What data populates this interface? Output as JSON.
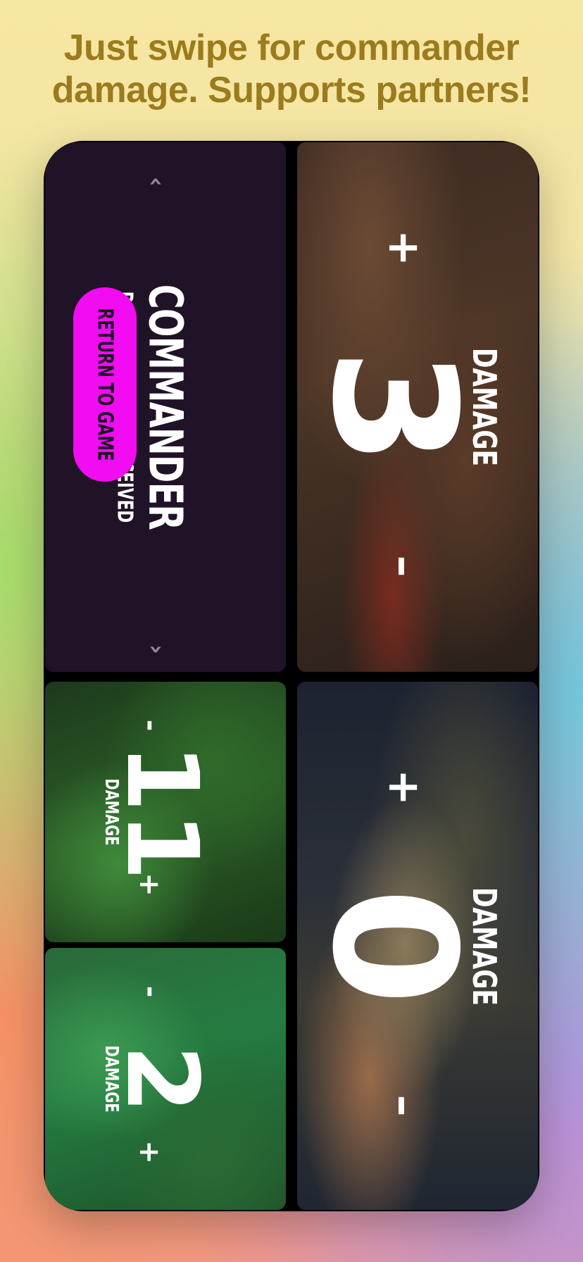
{
  "headline": {
    "line1": "Just swipe for commander",
    "line2": "damage. Supports partners!"
  },
  "commander_panel": {
    "title": "COMMANDER",
    "subtitle": "DAMAGE YOU'VE RECEIVED",
    "return_button": "RETURN TO GAME",
    "chevron_up": "‹",
    "chevron_down": "›"
  },
  "opponents": [
    {
      "damage": "3",
      "label": "DAMAGE",
      "plus": "+",
      "minus": "–"
    },
    {
      "damage": "0",
      "label": "DAMAGE",
      "plus": "+",
      "minus": "–"
    }
  ],
  "partners": [
    {
      "damage": "11",
      "label": "DAMAGE",
      "plus": "+",
      "minus": "-"
    },
    {
      "damage": "2",
      "label": "DAMAGE",
      "plus": "+",
      "minus": "-"
    }
  ],
  "colors": {
    "headline": "#9c7b1d",
    "accent_button": "#f20cf2",
    "commander_bg": "#211327"
  }
}
